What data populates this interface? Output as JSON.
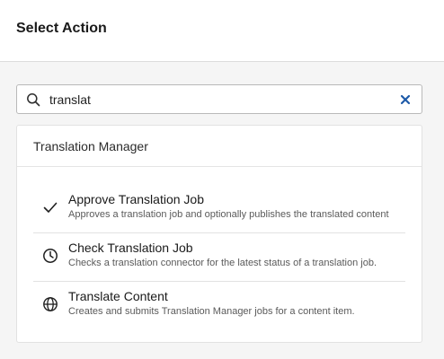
{
  "header": {
    "title": "Select Action"
  },
  "search": {
    "value": "translat",
    "icon": "search-icon",
    "clear_icon": "close-icon"
  },
  "group": {
    "title": "Translation Manager",
    "items": [
      {
        "name": "Approve Translation Job",
        "description": "Approves a translation job and optionally publishes the translated content",
        "icon": "check-icon"
      },
      {
        "name": "Check Translation Job",
        "description": "Checks a translation connector for the latest status of a translation job.",
        "icon": "clock-icon"
      },
      {
        "name": "Translate Content",
        "description": "Creates and submits Translation Manager jobs for a content item.",
        "icon": "globe-icon"
      }
    ]
  },
  "colors": {
    "clear_icon": "#1e5aa8",
    "text": "#1f1f1f",
    "muted": "#5a5a5a"
  }
}
